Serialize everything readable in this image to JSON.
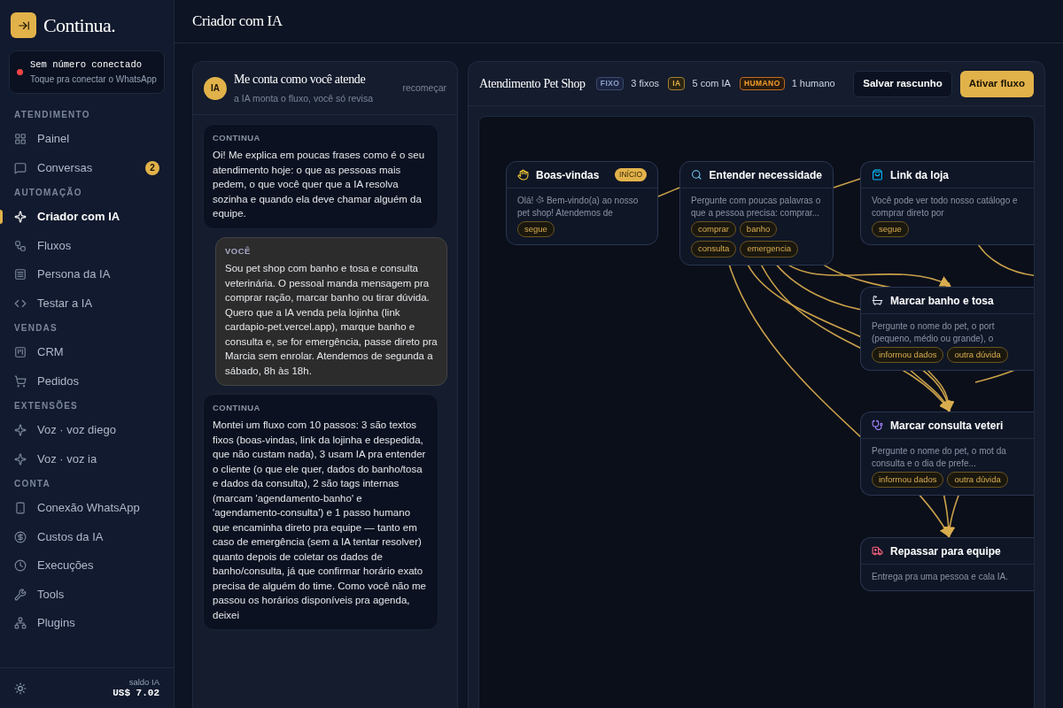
{
  "brand": {
    "name": "Continua."
  },
  "connection": {
    "title": "Sem número conectado",
    "subtitle": "Toque pra conectar o WhatsApp",
    "color": "#ef4444"
  },
  "sidebar": {
    "sections": [
      {
        "title": "ATENDIMENTO",
        "items": [
          {
            "label": "Painel",
            "selected": false
          },
          {
            "label": "Conversas",
            "selected": false,
            "badge": "2"
          }
        ]
      },
      {
        "title": "AUTOMAÇÃO",
        "items": [
          {
            "label": "Criador com IA",
            "selected": true
          },
          {
            "label": "Fluxos",
            "selected": false
          },
          {
            "label": "Persona da IA",
            "selected": false
          },
          {
            "label": "Testar a IA",
            "selected": false
          }
        ]
      },
      {
        "title": "VENDAS",
        "items": [
          {
            "label": "CRM",
            "selected": false
          },
          {
            "label": "Pedidos",
            "selected": false
          }
        ]
      },
      {
        "title": "EXTENSÕES",
        "items": [
          {
            "label": "Voz · voz diego",
            "selected": false
          },
          {
            "label": "Voz · voz ia",
            "selected": false
          }
        ]
      },
      {
        "title": "CONTA",
        "items": [
          {
            "label": "Conexão WhatsApp",
            "selected": false
          },
          {
            "label": "Custos da IA",
            "selected": false
          },
          {
            "label": "Execuções",
            "selected": false
          },
          {
            "label": "Tools",
            "selected": false
          },
          {
            "label": "Plugins",
            "selected": false
          }
        ]
      }
    ],
    "balance": {
      "label": "saldo IA",
      "value": "US$ 7.02"
    }
  },
  "page": {
    "title": "Criador com IA"
  },
  "chat": {
    "avatar": "IA",
    "title": "Me conta como você atende",
    "subtitle": "a IA monta o fluxo, você só revisa",
    "reset": "recomeçar",
    "messages": [
      {
        "kind": "assistant",
        "sender": "CONTINUA",
        "text": "Oi! Me explica em poucas frases como é o seu atendimento hoje: o que as pessoas mais pedem, o que você quer que a IA resolva sozinha e quando ela deve chamar alguém da equipe."
      },
      {
        "kind": "user",
        "sender": "VOCÊ",
        "text": "Sou pet shop com banho e tosa e consulta veterinária. O pessoal manda mensagem pra comprar ração, marcar banho ou tirar dúvida. Quero que a IA venda pela lojinha (link cardapio-pet.vercel.app), marque banho e consulta e, se for emergência, passe direto pra Marcia sem enrolar. Atendemos de segunda a sábado, 8h às 18h."
      },
      {
        "kind": "assistant",
        "sender": "CONTINUA",
        "text": "Montei um fluxo com 10 passos: 3 são textos fixos (boas-vindas, link da lojinha e despedida, que não custam nada), 3 usam IA pra entender o cliente (o que ele quer, dados do banho/tosa e dados da consulta), 2 são tags internas (marcam 'agendamento-banho' e 'agendamento-consulta') e 1 passo humano que encaminha direto pra equipe — tanto em caso de emergência (sem a IA tentar resolver) quanto depois de coletar os dados de banho/consulta, já que confirmar horário exato precisa de alguém do time. Como você não me passou os horários disponíveis pra agenda, deixei"
      }
    ]
  },
  "flow": {
    "title": "Atendimento Pet Shop",
    "tags": [
      {
        "kind": "fixo",
        "label": "FIXO",
        "count": "3 fixos"
      },
      {
        "kind": "ia",
        "label": "IA",
        "count": "5 com IA"
      },
      {
        "kind": "humano",
        "label": "HUMANO",
        "count": "1 humano"
      }
    ],
    "buttons": [
      {
        "kind": "secondary",
        "label": "Salvar rascunho"
      },
      {
        "kind": "primary",
        "label": "Ativar fluxo"
      }
    ],
    "nodes": [
      {
        "kind": "hand",
        "title": "Boas-vindas",
        "badge": "INÍCIO",
        "description": [
          {
            "kind": "text",
            "text": "Olá!"
          },
          {
            "kind": "paw"
          },
          {
            "kind": "text",
            "text": "Bem-vindo(a) ao nosso pet shop! Atendemos de"
          }
        ],
        "outputs": [
          "segue"
        ]
      },
      {
        "kind": "search",
        "title": "Entender necessidade",
        "description": [
          {
            "kind": "text",
            "text": "Pergunte com poucas palavras o que a pessoa precisa: comprar..."
          }
        ],
        "outputs": [
          "comprar",
          "banho",
          "consulta",
          "emergencia"
        ]
      },
      {
        "kind": "bag",
        "title": "Link da loja",
        "description": [
          {
            "kind": "text",
            "text": "Você pode ver todo nosso catálogo e comprar direto por"
          }
        ],
        "outputs": [
          "segue"
        ]
      },
      {
        "kind": "bath",
        "title": "Marcar banho e tosa",
        "description": [
          {
            "kind": "text",
            "text": "Pergunte o nome do pet, o port (pequeno, médio ou grande), o"
          }
        ],
        "outputs": [
          "informou dados",
          "outra dúvida"
        ]
      },
      {
        "kind": "stethoscope",
        "title": "Marcar consulta veteri",
        "description": [
          {
            "kind": "text",
            "text": "Pergunte o nome do pet, o mot da consulta e o dia de prefe..."
          }
        ],
        "outputs": [
          "informou dados",
          "outra dúvida"
        ]
      },
      {
        "kind": "ambulance",
        "title": "Repassar para equipe",
        "description": [
          {
            "kind": "text",
            "text": "Entrega pra uma pessoa e cala IA."
          }
        ]
      }
    ]
  }
}
